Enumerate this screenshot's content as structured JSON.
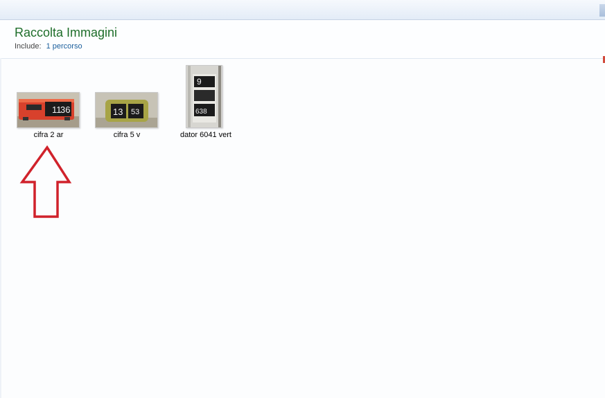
{
  "library": {
    "title": "Raccolta Immagini",
    "include_label": "Include:",
    "include_link": "1 percorso"
  },
  "files": [
    {
      "name": "cifra 2 ar"
    },
    {
      "name": "cifra 5 v"
    },
    {
      "name": "dator 6041 vert"
    }
  ],
  "thumbs": {
    "cifra_2_ar": {
      "hours": "11",
      "minutes": "36"
    },
    "cifra_5_v": {
      "hours": "13",
      "minutes": "53"
    },
    "dator_6041_vert": {
      "top": "9",
      "bottom": "638"
    }
  },
  "annotation": {
    "arrow_color": "#d0222b"
  }
}
